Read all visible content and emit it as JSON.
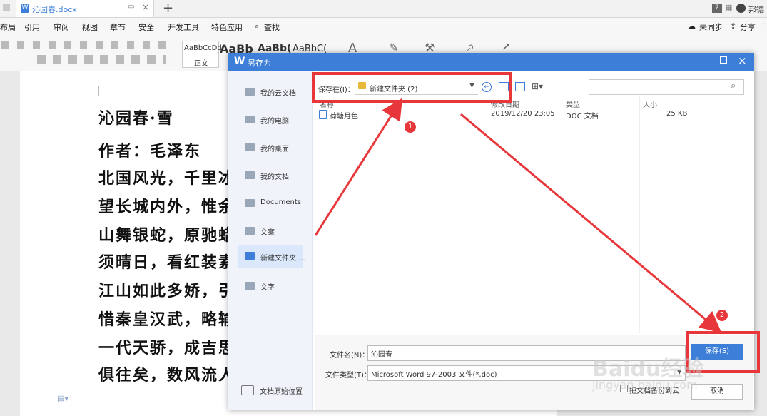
{
  "tabs": {
    "doc_tab": "沁园春.docx",
    "page_count": "2",
    "user": "邦德"
  },
  "menu": [
    "布局",
    "引用",
    "审阅",
    "视图",
    "章节",
    "安全",
    "开发工具",
    "特色应用",
    "查找"
  ],
  "menu_right": {
    "sync": "未同步",
    "share": "分享"
  },
  "ribbon": {
    "style1": "AaBbCcDd",
    "style1_name": "正文",
    "style2": "AaBb",
    "style3": "AaBb(",
    "style4": "AaBbC("
  },
  "document": {
    "lines": [
      "沁园春·雪",
      "作者：毛泽东",
      "北国风光，千里冰",
      "望长城内外，惟余",
      "山舞银蛇，原驰蜡",
      "须晴日，看红装素",
      "江山如此多娇，引",
      "惜秦皇汉武，略输",
      "一代天骄，成吉思",
      "俱往矣，数风流人"
    ]
  },
  "dialog": {
    "title": "另存为",
    "save_in_label": "保存在(I)：",
    "save_in_value": "新建文件夹 (2)",
    "search_placeholder": "",
    "sidebar": [
      {
        "label": "我的云文档",
        "icon": "cloud-icon"
      },
      {
        "label": "我的电脑",
        "icon": "computer-icon"
      },
      {
        "label": "我的桌面",
        "icon": "desktop-icon"
      },
      {
        "label": "我的文档",
        "icon": "folder-icon"
      },
      {
        "label": "Documents",
        "icon": "folder-icon"
      },
      {
        "label": "文案",
        "icon": "folder-icon"
      },
      {
        "label": "新建文件夹 ...",
        "icon": "folder-icon"
      },
      {
        "label": "文字",
        "icon": "folder-icon"
      }
    ],
    "original_location": "文档原始位置",
    "columns": {
      "name": "名称",
      "date": "修改日期",
      "type": "类型",
      "size": "大小"
    },
    "files": [
      {
        "name": "荷塘月色",
        "date": "2019/12/20 23:05",
        "type": "DOC 文档",
        "size": "25 KB"
      }
    ],
    "filename_label": "文件名(N)：",
    "filename_value": "沁园春",
    "filetype_label": "文件类型(T)：",
    "filetype_value": "Microsoft Word 97-2003 文件(*.doc)",
    "save_button": "保存(S)",
    "cancel_button": "取消",
    "encrypt_text": "把文档备份到云"
  },
  "annotations": {
    "step1": "1",
    "step2": "2"
  },
  "watermark": {
    "text": "Baidu经验",
    "url": "jingyan.baidu.com"
  },
  "colors": {
    "accent": "#3d7fd8",
    "annotation": "#e8373a"
  }
}
